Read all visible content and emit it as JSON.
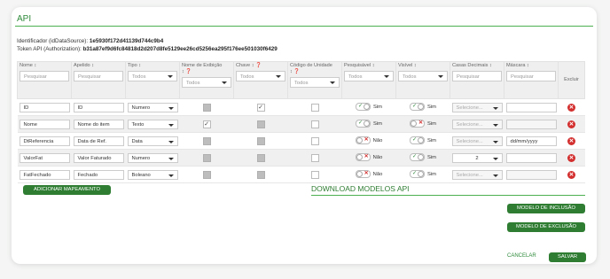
{
  "section_title": "API",
  "identifier": {
    "label": "Identificador (idDataSource):",
    "value": "1e5930f172d41139d744c9b4"
  },
  "token": {
    "label": "Token API (Authorization):",
    "value": "b31a87ef9d6fc84818d2d207d8fe5129ee26cd5256ea295f176ee501030f6429"
  },
  "headers": {
    "nome": "Nome ↕",
    "apelido": "Apelido ↕",
    "tipo": "Tipo ↕",
    "nome_exibicao": "Nome de Exibição",
    "nome_exibicao_sub": "↕ ❓",
    "chave": "Chave ↕ ❓",
    "codigo_unidade": "Código de Unidade",
    "codigo_unidade_sub": "↕ ❓",
    "pesquisavel": "Pesquisável ↕",
    "visivel": "Visível ↕",
    "casas_decimais": "Casas Decimais ↕",
    "mascara": "Máscara ↕",
    "excluir": "Excluir"
  },
  "filters": {
    "pesquisar": "Pesquisar",
    "todos": "Todos"
  },
  "rows": [
    {
      "nome": "ID",
      "apelido": "ID",
      "tipo": "Numero",
      "nome_exibicao": "disabled",
      "chave": "checked",
      "codigo_unidade": "unchecked",
      "pesquisavel": "Sim",
      "visivel": "Sim",
      "casas": "Selecione...",
      "mascara": ""
    },
    {
      "nome": "Nome",
      "apelido": "Nome do item",
      "tipo": "Texto",
      "nome_exibicao": "checked",
      "chave": "disabled",
      "codigo_unidade": "unchecked",
      "pesquisavel": "Sim",
      "visivel": "Sim",
      "casas": "Selecione...",
      "mascara": ""
    },
    {
      "nome": "DtReferencia",
      "apelido": "Data de Ref.",
      "tipo": "Data",
      "nome_exibicao": "disabled",
      "chave": "disabled",
      "codigo_unidade": "unchecked",
      "pesquisavel": "Não",
      "visivel": "Sim",
      "casas": "Selecione...",
      "mascara": "dd/mm/yyyy"
    },
    {
      "nome": "ValorFat",
      "apelido": "Valor Faturado",
      "tipo": "Numero",
      "nome_exibicao": "disabled",
      "chave": "disabled",
      "codigo_unidade": "unchecked",
      "pesquisavel": "Não",
      "visivel": "Sim",
      "casas": "2",
      "mascara": ""
    },
    {
      "nome": "FatFechado",
      "apelido": "Fechado",
      "tipo": "Boleano",
      "nome_exibicao": "disabled",
      "chave": "disabled",
      "codigo_unidade": "unchecked",
      "pesquisavel": "Não",
      "visivel": "Sim",
      "casas": "Selecione...",
      "mascara": ""
    }
  ],
  "toggle_marks": {
    "on": "✓",
    "off": "✕"
  },
  "delete_glyph": "✕",
  "buttons": {
    "add_mapping": "ADICIONAR MAPEAMENTO",
    "download_title": "DOWNLOAD MODELOS API",
    "inclusion": "MODELO DE INCLUSÃO",
    "exclusion": "MODELO DE EXCLUSÃO",
    "cancel": "CANCELAR",
    "save": "SALVAR"
  },
  "colors": {
    "accent": "#2e7d32",
    "danger": "#d32f2f"
  }
}
